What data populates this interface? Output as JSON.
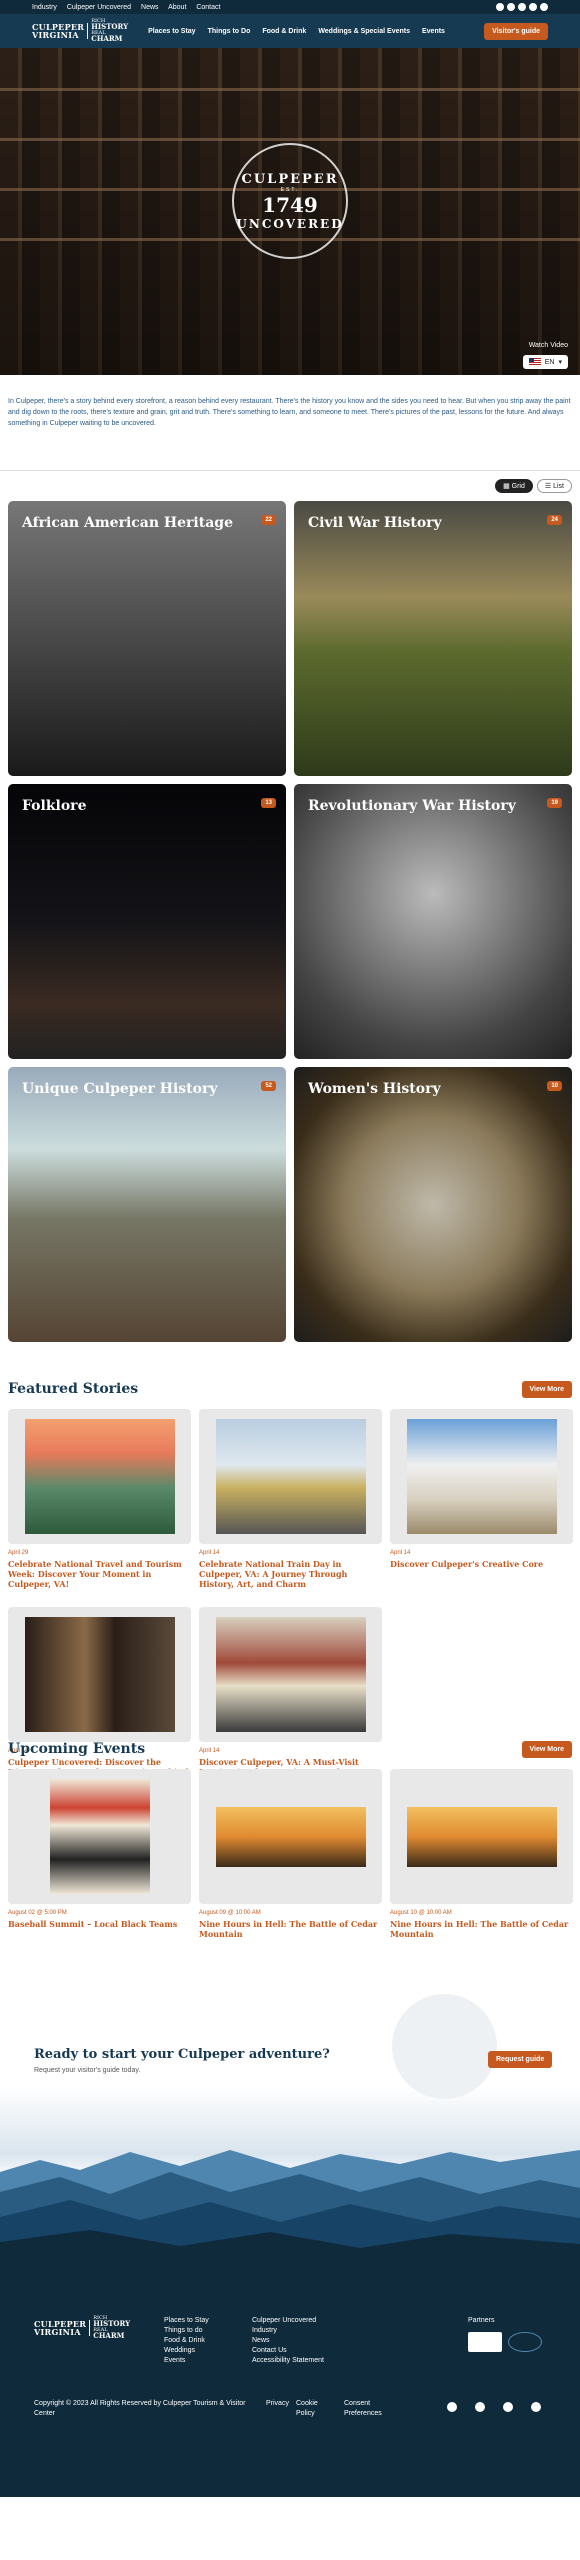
{
  "util_bar": {
    "links": [
      "Industry",
      "Culpeper Uncovered",
      "News",
      "About",
      "Contact"
    ],
    "social_icons": [
      "facebook-icon",
      "youtube-icon",
      "pinterest-icon",
      "instagram-icon",
      "search-icon"
    ]
  },
  "nav": {
    "logo": {
      "line1": "CULPEPER",
      "line2": "VIRGINIA",
      "side1": "RICH",
      "side2": "HISTORY",
      "side3": "REAL",
      "side4": "CHARM"
    },
    "menu": [
      "Places to Stay",
      "Things to Do",
      "Food & Drink",
      "Weddings & Special Events",
      "Events"
    ],
    "cta": "Visitor's guide"
  },
  "hero": {
    "badge": {
      "top": "CULPEPER",
      "est": "EST.",
      "year": "1749",
      "bottom": "UNCOVERED"
    },
    "watch": "Watch Video",
    "lang": "EN"
  },
  "intro": "In Culpeper, there's a story behind every storefront, a reason behind every restaurant. There's the history you know and the sides you need to hear. But when you strip away the paint and dig down to the roots, there's texture and grain, grit and truth. There's something to learn, and someone to meet. There's pictures of the past, lessons for the future. And always something in Culpeper waiting to be uncovered.",
  "view_toggle": {
    "grid": "Grid",
    "list": "List"
  },
  "categories": [
    {
      "title": "African American Heritage",
      "count": "22"
    },
    {
      "title": "Civil War History",
      "count": "24"
    },
    {
      "title": "Folklore",
      "count": "13"
    },
    {
      "title": "Revolutionary War History",
      "count": "19"
    },
    {
      "title": "Unique Culpeper History",
      "count": "52"
    },
    {
      "title": "Women's History",
      "count": "10"
    }
  ],
  "featured": {
    "heading": "Featured Stories",
    "button": "View More",
    "items": [
      {
        "date": "April 29",
        "title": "Celebrate National Travel and Tourism Week: Discover Your Moment in Culpeper, VA!"
      },
      {
        "date": "April 14",
        "title": "Celebrate National Train Day in Culpeper, VA: A Journey Through History, Art, and Charm"
      },
      {
        "date": "April 14",
        "title": "Discover Culpeper's Creative Core"
      },
      {
        "date": "April 14",
        "title": "Culpeper Uncovered: Discover the History, Culture and Community Behind the Town"
      },
      {
        "date": "April 14",
        "title": "Discover Culpeper, VA: A Must-Visit Destination for America's 250th Celebration"
      }
    ]
  },
  "events": {
    "heading": "Upcoming Events",
    "button": "View More",
    "items": [
      {
        "date": "August 02 @ 5:00 PM",
        "title": "Baseball Summit – Local Black Teams"
      },
      {
        "date": "August 09 @ 10:00 AM",
        "title": "Nine Hours in Hell: The Battle of Cedar Mountain"
      },
      {
        "date": "August 10 @ 10:00 AM",
        "title": "Nine Hours in Hell: The Battle of Cedar Mountain"
      }
    ]
  },
  "cta": {
    "heading": "Ready to start your Culpeper adventure?",
    "sub": "Request your visitor's guide today.",
    "button": "Request guide"
  },
  "footer": {
    "col1": [
      "Places to Stay",
      "Things to do",
      "Food & Drink",
      "Weddings",
      "Events"
    ],
    "col2": [
      "Culpeper Uncovered",
      "Industry",
      "News",
      "Contact Us",
      "Accessibility Statement"
    ],
    "partners": "Partners",
    "copyright": "Copyright © 2023 All Rights Reserved by Culpeper Tourism & Visitor Center",
    "legal": [
      "Privacy",
      "Cookie Policy",
      "Consent Preferences"
    ]
  }
}
